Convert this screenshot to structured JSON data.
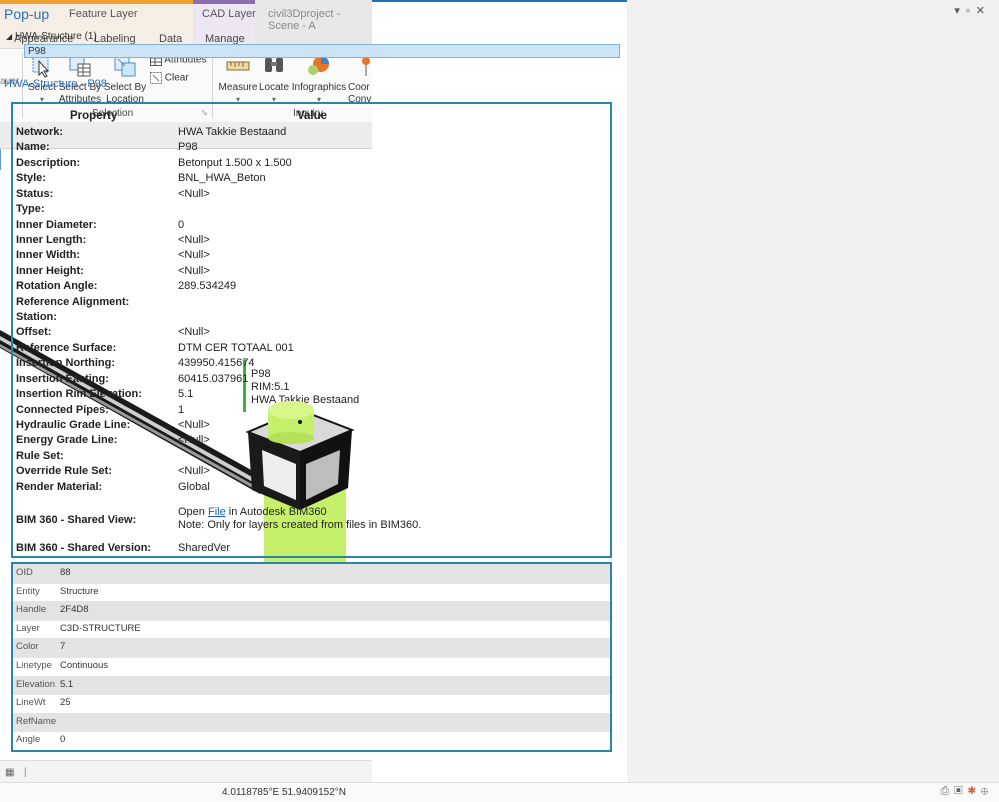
{
  "ribbon": {
    "context_tabs": [
      {
        "label": "Feature Layer",
        "color": "#f0a030"
      },
      {
        "label": "CAD Layer",
        "color": "#8a6fb3"
      }
    ],
    "project_title": "civil3Dproject - Scene - A",
    "tabs": [
      "Appearance",
      "Labeling",
      "Data",
      "Manage"
    ],
    "layer_label": "ayer",
    "selection": {
      "select": "Select",
      "select_by_attributes_1": "Select By",
      "select_by_attributes_2": "Attributes",
      "select_by_location_1": "Select By",
      "select_by_location_2": "Location",
      "attributes": "Attributes",
      "clear": "Clear",
      "group": "Selection"
    },
    "inquiry": {
      "measure": "Measure",
      "locate": "Locate",
      "infographics": "Infographics",
      "coor_1": "Coor",
      "coor_2": "Conv",
      "group": "Inquiry"
    }
  },
  "scene": {
    "label_id": "P98",
    "label_rim": "RIM:5.1",
    "label_network": "HWA Takkie Bestaand",
    "colors": {
      "structure": "#c6f06a",
      "pipe": "#1a1a1a"
    }
  },
  "popup": {
    "title": "Pop-up",
    "tree_parent": "HWA-Structure  (1)",
    "tree_child": "P98",
    "feature_title": "HWA-Structure - P98",
    "headers": {
      "property": "Property",
      "value": "Value"
    },
    "properties": [
      {
        "k": "Network:",
        "v": "HWA Takkie Bestaand"
      },
      {
        "k": "Name:",
        "v": "P98"
      },
      {
        "k": "Description:",
        "v": "Betonput 1.500 x 1.500"
      },
      {
        "k": "Style:",
        "v": "BNL_HWA_Beton"
      },
      {
        "k": "Status:",
        "v": "<Null>"
      },
      {
        "k": "Type:",
        "v": ""
      },
      {
        "k": "Inner Diameter:",
        "v": "0"
      },
      {
        "k": "Inner Length:",
        "v": "<Null>"
      },
      {
        "k": "Inner Width:",
        "v": "<Null>"
      },
      {
        "k": "Inner Height:",
        "v": "<Null>"
      },
      {
        "k": "Rotation Angle:",
        "v": "289.534249"
      },
      {
        "k": "Reference Alignment:",
        "v": ""
      },
      {
        "k": "Station:",
        "v": ""
      },
      {
        "k": "Offset:",
        "v": "<Null>"
      },
      {
        "k": "Reference Surface:",
        "v": "DTM CER TOTAAL 001"
      },
      {
        "k": "Insertion Northing:",
        "v": "439950.415674"
      },
      {
        "k": "Insertion Easting:",
        "v": "60415.037961"
      },
      {
        "k": "Insertion Rim Elevation:",
        "v": "5.1"
      },
      {
        "k": "Connected Pipes:",
        "v": "1"
      },
      {
        "k": "Hydraulic Grade Line:",
        "v": "<Null>"
      },
      {
        "k": "Energy Grade Line:",
        "v": "<Null>"
      },
      {
        "k": "Rule Set:",
        "v": ""
      },
      {
        "k": "Override Rule Set:",
        "v": "<Null>"
      },
      {
        "k": "Render Material:",
        "v": "Global"
      }
    ],
    "bim_view": {
      "k": "BIM 360 - Shared View:",
      "open": "Open",
      "file": "File",
      "rest": "in Autodesk BIM360",
      "note": "Note: Only for layers created from files in BIM360."
    },
    "bim_version": {
      "k": "BIM 360 - Shared Version:",
      "v": "SharedVer"
    },
    "attributes": [
      {
        "k": "OID",
        "v": "88"
      },
      {
        "k": "Entity",
        "v": "Structure"
      },
      {
        "k": "Handle",
        "v": "2F4D8"
      },
      {
        "k": "Layer",
        "v": "C3D-STRUCTURE"
      },
      {
        "k": "Color",
        "v": "7"
      },
      {
        "k": "Linetype",
        "v": "Continuous"
      },
      {
        "k": "Elevation",
        "v": "5.1"
      },
      {
        "k": "LineWt",
        "v": "25"
      },
      {
        "k": "RefName",
        "v": ""
      },
      {
        "k": "Angle",
        "v": "0"
      }
    ],
    "coords": "4.0118785°E 51.9409152°N"
  }
}
